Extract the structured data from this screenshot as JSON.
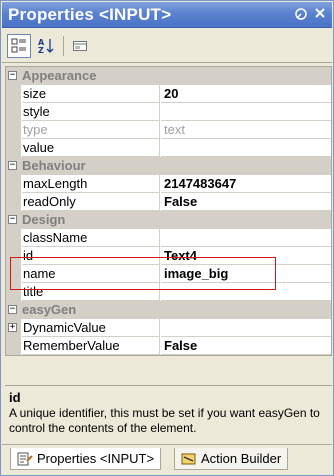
{
  "window": {
    "title": "Properties <INPUT>"
  },
  "toolbar": {
    "categorized_icon": "categorized-icon",
    "alphabetical_icon": "alphabetical-icon",
    "property_pages_icon": "property-pages-icon"
  },
  "grid": {
    "rows": [
      {
        "type": "category",
        "label": "Appearance"
      },
      {
        "type": "prop",
        "name": "size",
        "value": "20"
      },
      {
        "type": "prop",
        "name": "style",
        "value": ""
      },
      {
        "type": "prop",
        "name": "type",
        "value": "text",
        "disabled": true
      },
      {
        "type": "prop",
        "name": "value",
        "value": ""
      },
      {
        "type": "category",
        "label": "Behaviour"
      },
      {
        "type": "prop",
        "name": "maxLength",
        "value": "2147483647"
      },
      {
        "type": "prop",
        "name": "readOnly",
        "value": "False"
      },
      {
        "type": "category",
        "label": "Design"
      },
      {
        "type": "prop",
        "name": "className",
        "value": ""
      },
      {
        "type": "prop",
        "name": "id",
        "value": "Text4"
      },
      {
        "type": "prop",
        "name": "name",
        "value": "image_big"
      },
      {
        "type": "prop",
        "name": "title",
        "value": ""
      },
      {
        "type": "category",
        "label": "easyGen"
      },
      {
        "type": "prop",
        "name": "DynamicValue",
        "value": "",
        "expandable": true
      },
      {
        "type": "prop",
        "name": "RememberValue",
        "value": "False"
      }
    ]
  },
  "description": {
    "title": "id",
    "text": "A unique identifier, this must be set if you want easyGen to control the contents of the element."
  },
  "tabs": [
    {
      "label": "Properties <INPUT>",
      "active": true
    },
    {
      "label": "Action Builder",
      "active": false
    }
  ],
  "colors": {
    "title_bar": "#5b82cf",
    "category_bg": "#d4d0c8",
    "highlight": "#d01818"
  }
}
